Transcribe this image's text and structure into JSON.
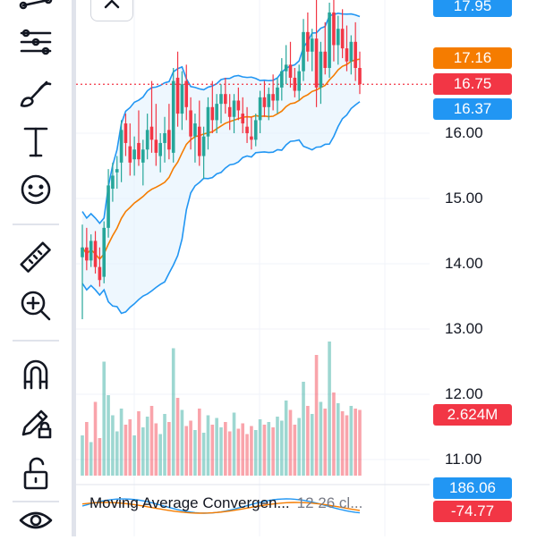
{
  "toolbar": {
    "tools": [
      {
        "icon": "trend-line-icon"
      },
      {
        "icon": "fib-retracement-icon"
      },
      {
        "icon": "brush-icon"
      },
      {
        "icon": "text-icon"
      },
      {
        "icon": "emoji-icon"
      },
      {
        "icon": "ruler-icon"
      },
      {
        "icon": "zoom-in-icon"
      },
      {
        "icon": "magnet-icon"
      },
      {
        "icon": "lock-drawings-icon"
      },
      {
        "icon": "unlock-icon"
      },
      {
        "icon": "eye-icon"
      }
    ]
  },
  "chart_data": {
    "type": "candlestick",
    "y_axis": {
      "range": [
        10.8,
        18.0
      ],
      "ticks": [
        "16.00",
        "15.00",
        "14.00",
        "13.00",
        "12.00",
        "11.00"
      ]
    },
    "price_badges": [
      {
        "name": "upper-band",
        "value": "17.95",
        "color": "#2196f3"
      },
      {
        "name": "high-level",
        "value": "17.16",
        "color": "#f57c00"
      },
      {
        "name": "last-price",
        "value": "16.75",
        "color": "#f23645"
      },
      {
        "name": "lower-band",
        "value": "16.37",
        "color": "#2196f3"
      }
    ],
    "volume_badge": {
      "value": "2.624M",
      "color": "#f23645"
    },
    "colors": {
      "up": "#26a69a",
      "down": "#f23645",
      "band": "#2196f3",
      "ma": "#f57c00",
      "band_fill": "#e3f2fd"
    },
    "candles": [
      [
        14.1,
        14.6,
        13.15,
        14.25
      ],
      [
        14.25,
        14.55,
        13.9,
        14.05
      ],
      [
        14.05,
        14.45,
        13.95,
        14.35
      ],
      [
        14.35,
        14.5,
        13.85,
        13.95
      ],
      [
        13.95,
        14.25,
        13.65,
        13.75
      ],
      [
        13.8,
        14.65,
        13.7,
        14.55
      ],
      [
        14.55,
        15.45,
        14.4,
        15.2
      ],
      [
        15.15,
        15.55,
        14.95,
        15.35
      ],
      [
        15.4,
        15.65,
        15.15,
        15.45
      ],
      [
        15.55,
        16.2,
        15.25,
        16.05
      ],
      [
        16.15,
        16.3,
        15.65,
        15.85
      ],
      [
        15.8,
        16.15,
        15.35,
        15.55
      ],
      [
        15.6,
        15.95,
        15.35,
        15.75
      ],
      [
        15.85,
        16.35,
        15.5,
        15.6
      ],
      [
        15.55,
        15.9,
        15.2,
        15.75
      ],
      [
        15.75,
        16.3,
        15.6,
        16.05
      ],
      [
        16.1,
        16.8,
        15.7,
        15.9
      ],
      [
        15.9,
        16.45,
        15.5,
        15.7
      ],
      [
        15.65,
        16.0,
        15.4,
        15.85
      ],
      [
        15.85,
        16.25,
        15.55,
        16.0
      ],
      [
        16.05,
        16.45,
        15.6,
        15.75
      ],
      [
        15.7,
        17.0,
        15.55,
        16.8
      ],
      [
        16.85,
        17.25,
        16.1,
        16.3
      ],
      [
        16.3,
        16.95,
        16.05,
        16.75
      ],
      [
        16.8,
        17.05,
        16.2,
        16.4
      ],
      [
        16.35,
        16.55,
        15.75,
        15.95
      ],
      [
        15.95,
        16.3,
        15.55,
        16.15
      ],
      [
        16.1,
        16.5,
        15.5,
        15.65
      ],
      [
        15.65,
        16.1,
        15.3,
        15.95
      ],
      [
        15.95,
        16.55,
        15.75,
        16.4
      ],
      [
        16.4,
        16.8,
        16.0,
        16.2
      ],
      [
        16.2,
        16.6,
        16.0,
        16.45
      ],
      [
        16.45,
        16.75,
        16.15,
        16.6
      ],
      [
        16.6,
        16.85,
        16.3,
        16.45
      ],
      [
        16.4,
        16.6,
        16.05,
        16.25
      ],
      [
        16.25,
        16.6,
        16.0,
        16.5
      ],
      [
        16.5,
        16.7,
        16.2,
        16.35
      ],
      [
        16.3,
        16.55,
        16.0,
        16.15
      ],
      [
        16.1,
        16.4,
        15.85,
        16.0
      ],
      [
        15.95,
        16.25,
        15.75,
        15.9
      ],
      [
        15.9,
        16.3,
        15.8,
        16.2
      ],
      [
        16.2,
        16.65,
        16.0,
        16.55
      ],
      [
        16.55,
        16.8,
        16.25,
        16.4
      ],
      [
        16.4,
        16.7,
        16.2,
        16.6
      ],
      [
        16.6,
        16.9,
        16.35,
        16.5
      ],
      [
        16.5,
        16.85,
        16.3,
        16.7
      ],
      [
        16.7,
        17.15,
        16.5,
        16.95
      ],
      [
        16.95,
        17.35,
        16.75,
        17.05
      ],
      [
        17.05,
        17.4,
        16.7,
        16.85
      ],
      [
        16.85,
        17.0,
        16.55,
        16.65
      ],
      [
        16.65,
        17.05,
        16.5,
        16.95
      ],
      [
        16.95,
        17.75,
        16.8,
        17.55
      ],
      [
        17.55,
        17.85,
        17.1,
        17.25
      ],
      [
        17.25,
        17.6,
        16.95,
        17.45
      ],
      [
        17.45,
        18.05,
        16.4,
        16.7
      ],
      [
        16.7,
        17.4,
        16.45,
        17.25
      ],
      [
        17.25,
        17.7,
        16.9,
        17.0
      ],
      [
        17.0,
        18.0,
        16.85,
        17.85
      ],
      [
        17.85,
        18.2,
        17.1,
        17.35
      ],
      [
        17.35,
        17.8,
        17.05,
        17.6
      ],
      [
        17.6,
        17.9,
        17.15,
        17.3
      ],
      [
        17.3,
        17.65,
        16.95,
        17.1
      ],
      [
        17.1,
        17.5,
        16.9,
        17.4
      ],
      [
        17.4,
        17.7,
        16.8,
        17.0
      ],
      [
        17.0,
        17.25,
        16.6,
        16.75
      ]
    ],
    "volumes": [
      0.3,
      0.4,
      0.25,
      0.55,
      0.28,
      0.85,
      0.6,
      0.45,
      0.33,
      0.5,
      0.38,
      0.42,
      0.3,
      0.48,
      0.36,
      0.44,
      0.52,
      0.39,
      0.31,
      0.46,
      0.4,
      0.95,
      0.58,
      0.49,
      0.37,
      0.41,
      0.34,
      0.5,
      0.32,
      0.45,
      0.38,
      0.43,
      0.36,
      0.4,
      0.33,
      0.47,
      0.35,
      0.39,
      0.31,
      0.37,
      0.34,
      0.42,
      0.38,
      0.4,
      0.36,
      0.44,
      0.41,
      0.56,
      0.49,
      0.38,
      0.43,
      0.7,
      0.52,
      0.46,
      0.9,
      0.55,
      0.5,
      1.0,
      0.62,
      0.54,
      0.48,
      0.45,
      0.52,
      0.5,
      0.49
    ],
    "macd": {
      "title": "Moving Average Convergen...",
      "params": "12 26 cl...",
      "values": [
        "186.06",
        "-74.77"
      ]
    }
  }
}
